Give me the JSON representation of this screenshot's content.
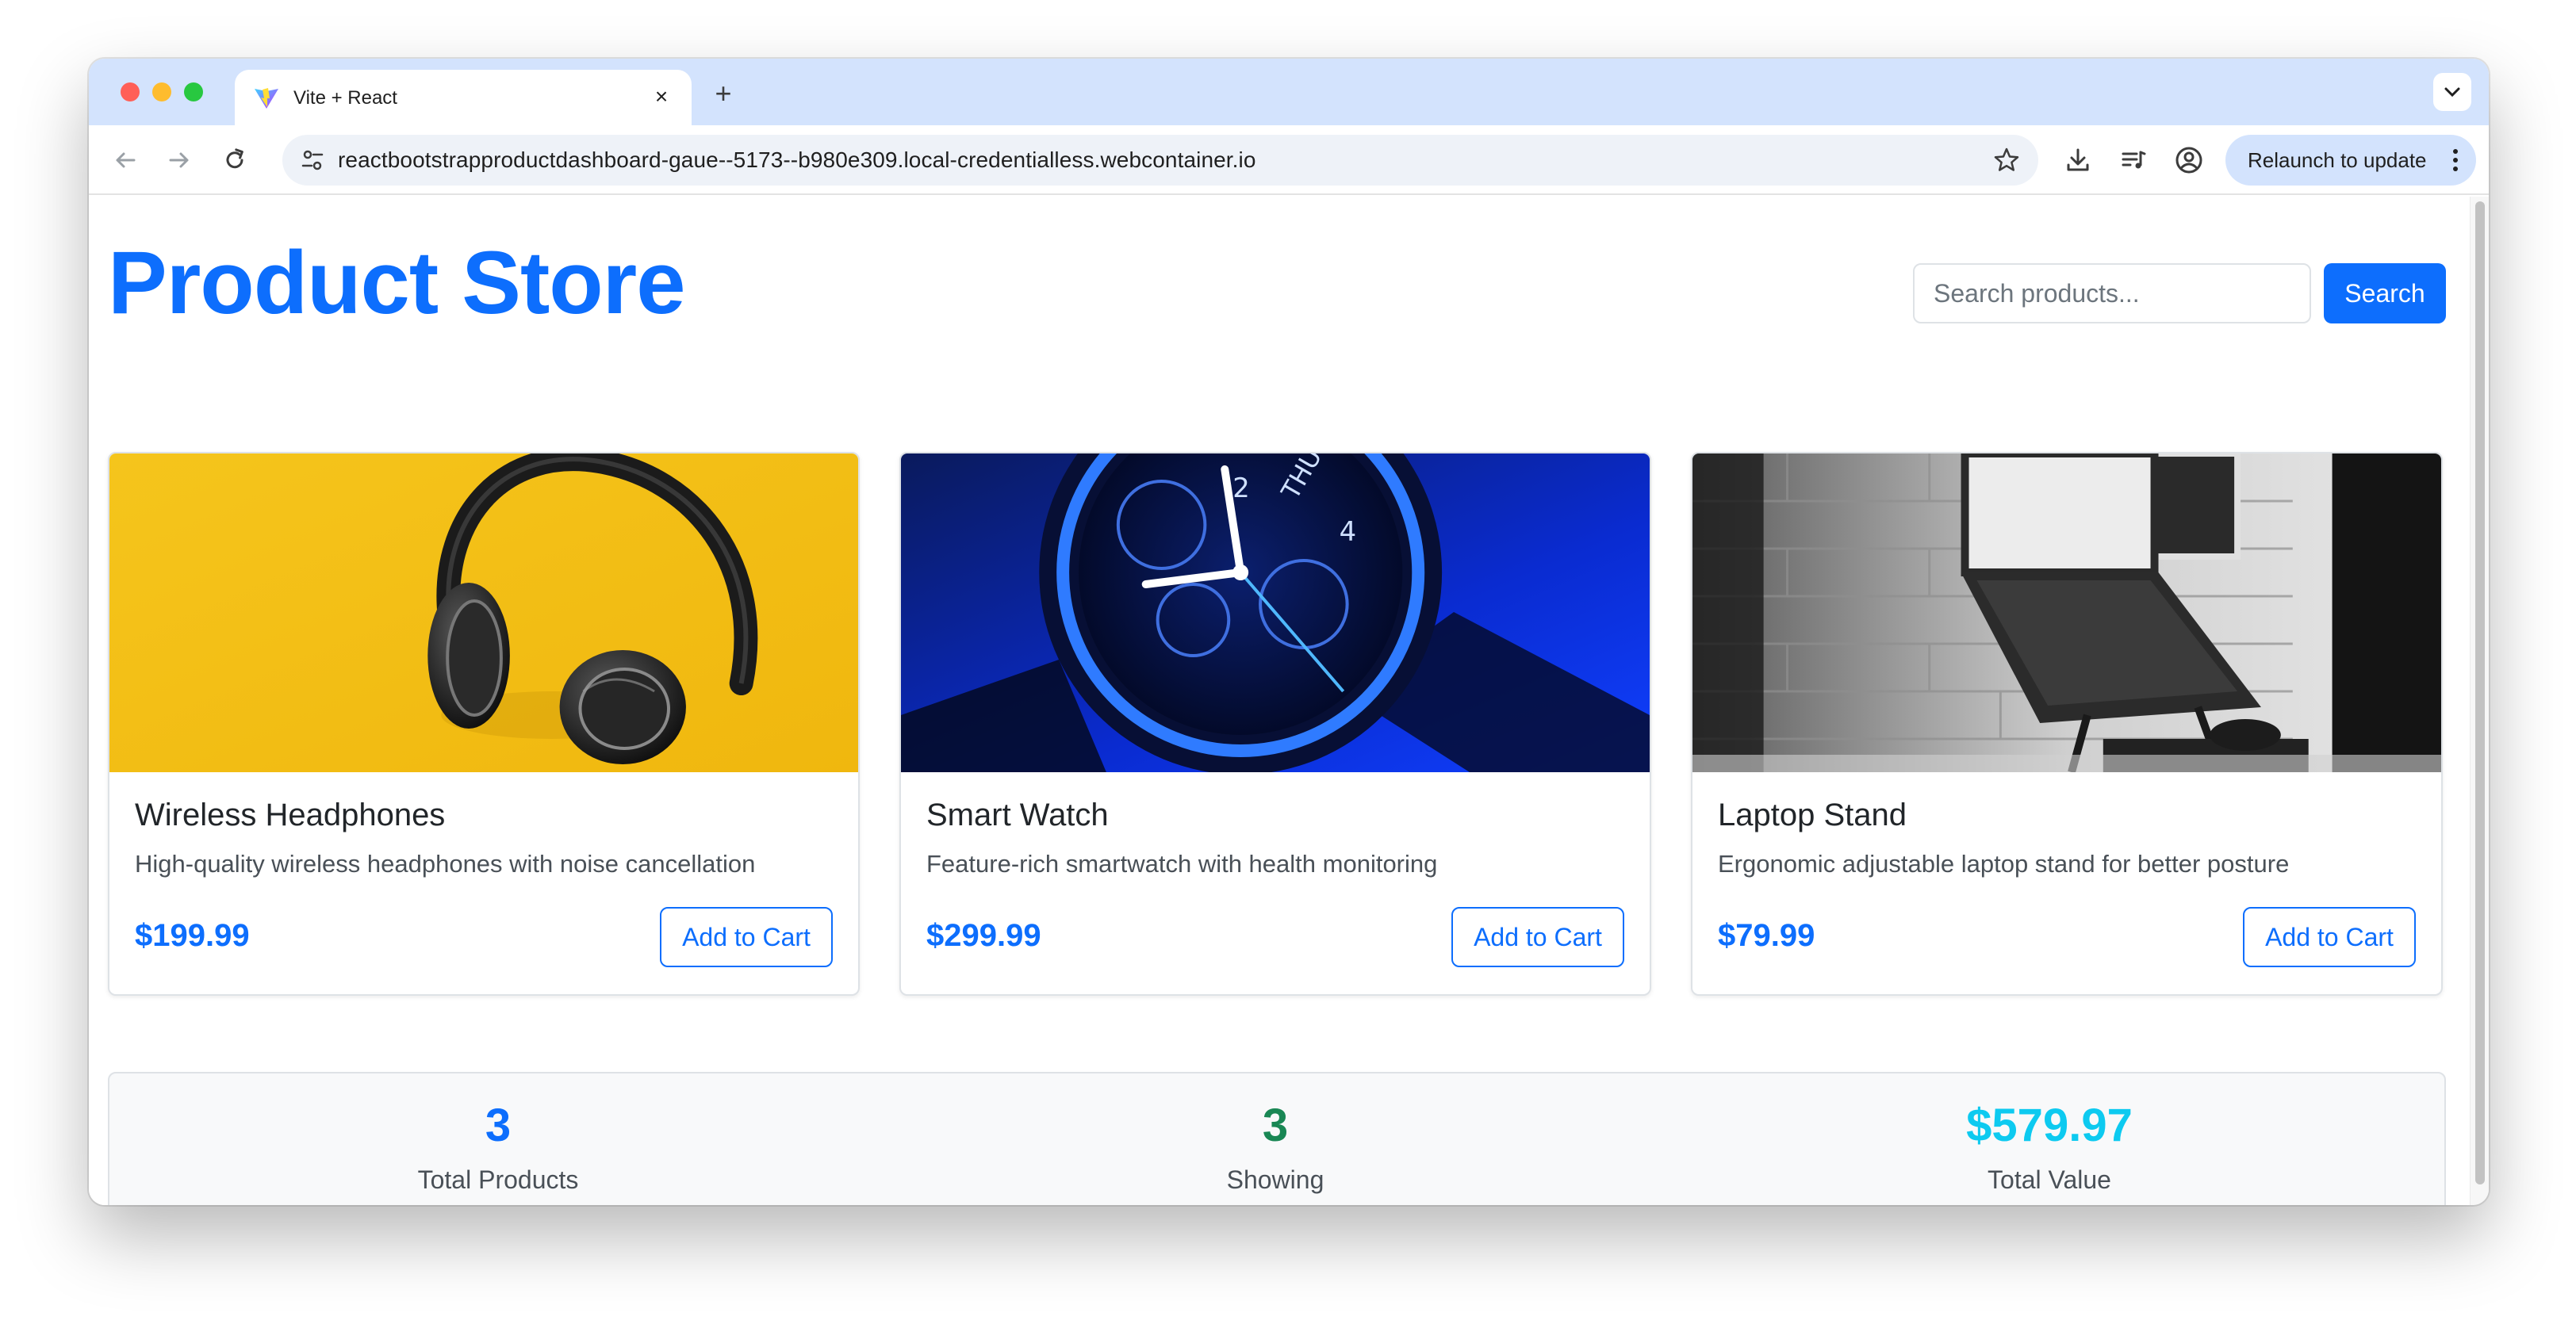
{
  "browser": {
    "tab_title": "Vite + React",
    "url": "reactbootstrapproductdashboard-gaue--5173--b980e309.local-credentialless.webcontainer.io",
    "relaunch_label": "Relaunch to update",
    "icons": [
      "back-arrow-icon",
      "forward-arrow-icon",
      "reload-icon",
      "site-info-icon",
      "bookmark-star-icon",
      "download-icon",
      "media-controls-icon",
      "profile-icon",
      "kebab-menu-icon",
      "vite-logo-icon",
      "close-icon",
      "plus-icon",
      "chevron-down-icon"
    ]
  },
  "header": {
    "title": "Product Store",
    "search_placeholder": "Search products...",
    "search_button": "Search"
  },
  "products": [
    {
      "title": "Wireless Headphones",
      "description": "High-quality wireless headphones with noise cancellation",
      "price": "$199.99",
      "button": "Add to Cart",
      "image": "headphones-photo"
    },
    {
      "title": "Smart Watch",
      "description": "Feature-rich smartwatch with health monitoring",
      "price": "$299.99",
      "button": "Add to Cart",
      "image": "smartwatch-photo"
    },
    {
      "title": "Laptop Stand",
      "description": "Ergonomic adjustable laptop stand for better posture",
      "price": "$79.99",
      "button": "Add to Cart",
      "image": "laptop-stand-photo"
    }
  ],
  "stats": [
    {
      "value": "3",
      "label": "Total Products",
      "color": "#0d6efd"
    },
    {
      "value": "3",
      "label": "Showing",
      "color": "#198754"
    },
    {
      "value": "$579.97",
      "label": "Total Value",
      "color": "#0dcaf0"
    }
  ],
  "colors": {
    "primary": "#0d6efd",
    "success": "#198754",
    "info": "#0dcaf0",
    "tabstrip": "#d3e3fd"
  }
}
